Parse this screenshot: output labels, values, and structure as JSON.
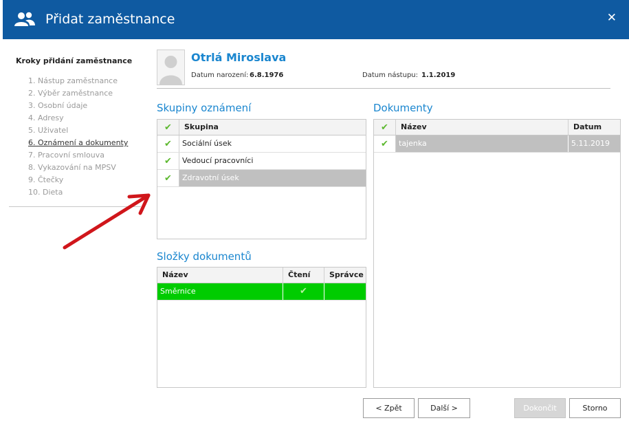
{
  "window": {
    "title": "Přidat zaměstnance",
    "close_glyph": "✕",
    "icon": "users-icon"
  },
  "steps": {
    "title": "Kroky přidání zaměstnance",
    "items": [
      "1. Nástup zaměstnance",
      "2. Výběr zaměstnance",
      "3. Osobní údaje",
      "4. Adresy",
      "5. Uživatel",
      "6. Oznámení a dokumenty",
      "7. Pracovní smlouva",
      "8. Vykazování na MPSV",
      "9. Čtečky",
      "10. Dieta"
    ],
    "active_index": 5
  },
  "employee": {
    "name": "Otrlá Miroslava",
    "dob_label": "Datum narození:",
    "dob_value": "6.8.1976",
    "start_label": "Datum nástupu:",
    "start_value": "1.1.2019"
  },
  "groups": {
    "title": "Skupiny oznámení",
    "header_check": "✔",
    "column": "Skupina",
    "rows": [
      {
        "checked": true,
        "name": "Sociální úsek"
      },
      {
        "checked": true,
        "name": "Vedoucí pracovníci"
      },
      {
        "checked": true,
        "name": "Zdravotní úsek",
        "selected": true
      }
    ]
  },
  "folders": {
    "title": "Složky dokumentů",
    "columns": [
      "Název",
      "Čtení",
      "Správce"
    ],
    "rows": [
      {
        "name": "Směrnice",
        "read": true,
        "admin": false,
        "selected": true
      }
    ]
  },
  "documents": {
    "title": "Dokumenty",
    "header_check": "✔",
    "columns": [
      "Název",
      "Datum"
    ],
    "rows": [
      {
        "checked": true,
        "name": "tajenka",
        "date": "5.11.2019",
        "selected": true
      }
    ]
  },
  "buttons": {
    "back": "< Zpět",
    "next": "Další >",
    "finish": "Dokončit",
    "cancel": "Storno"
  },
  "colors": {
    "titlebar": "#0f5aa1",
    "accent": "#1a86cf",
    "check": "#5cb82e",
    "selected_green": "#00cc00",
    "selected_gray": "#c0c0c0",
    "arrow": "#d0161b"
  }
}
